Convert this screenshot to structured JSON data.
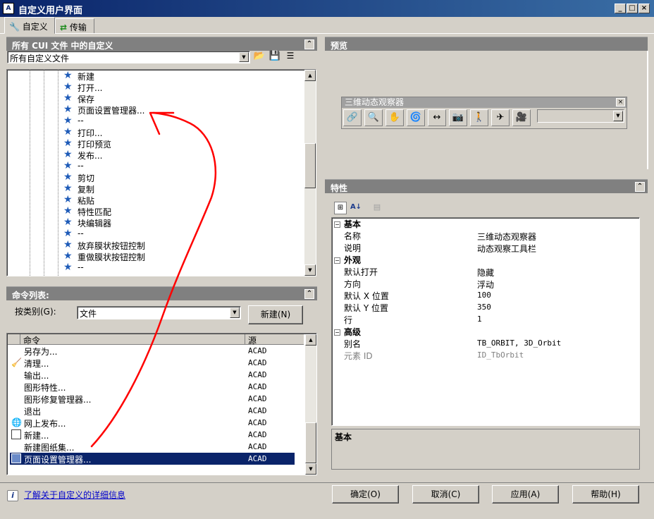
{
  "window": {
    "title": "自定义用户界面",
    "buttons": [
      "_",
      "□",
      "×"
    ]
  },
  "tabs": [
    {
      "label": "自定义"
    },
    {
      "label": "传输"
    }
  ],
  "cui_panel": {
    "title": "所有 CUI 文件 中的自定义",
    "file_filter": "所有自定义文件",
    "tree_items": [
      "新建",
      "打开...",
      "保存",
      "页面设置管理器...",
      "--",
      "打印...",
      "打印预览",
      "发布...",
      "--",
      "剪切",
      "复制",
      "粘贴",
      "特性匹配",
      "块编辑器",
      "--",
      "放弃膜状按钮控制",
      "重做膜状按钮控制",
      "--"
    ]
  },
  "command_panel": {
    "title": "命令列表:",
    "category_label": "按类别(G):",
    "category_value": "文件",
    "new_button": "新建(N)",
    "col_command": "命令",
    "col_source": "源",
    "rows": [
      {
        "name": "另存为...",
        "source": "ACAD",
        "icon": ""
      },
      {
        "name": "清理...",
        "source": "ACAD",
        "icon": "broom-icon"
      },
      {
        "name": "输出...",
        "source": "ACAD",
        "icon": ""
      },
      {
        "name": "图形特性...",
        "source": "ACAD",
        "icon": ""
      },
      {
        "name": "图形修复管理器...",
        "source": "ACAD",
        "icon": ""
      },
      {
        "name": "退出",
        "source": "ACAD",
        "icon": ""
      },
      {
        "name": "网上发布...",
        "source": "ACAD",
        "icon": "globe-icon"
      },
      {
        "name": "新建...",
        "source": "ACAD",
        "icon": "new-document-icon"
      },
      {
        "name": "新建图纸集...",
        "source": "ACAD",
        "icon": ""
      },
      {
        "name": "页面设置管理器...",
        "source": "ACAD",
        "icon": "page-setup-icon",
        "selected": true
      }
    ]
  },
  "preview_panel": {
    "title": "预览",
    "toolbar_title": "三维动态观察器"
  },
  "properties_panel": {
    "title": "特性",
    "groups": [
      {
        "name": "基本",
        "rows": [
          {
            "key": "名称",
            "value": "三维动态观察器"
          },
          {
            "key": "说明",
            "value": "动态观察工具栏"
          }
        ]
      },
      {
        "name": "外观",
        "rows": [
          {
            "key": "默认打开",
            "value": "隐藏"
          },
          {
            "key": "方向",
            "value": "浮动"
          },
          {
            "key": "默认 X 位置",
            "value": "100"
          },
          {
            "key": "默认 Y 位置",
            "value": "350"
          },
          {
            "key": "行",
            "value": "1"
          }
        ]
      },
      {
        "name": "高级",
        "rows": [
          {
            "key": "别名",
            "value": "TB_ORBIT, 3D_Orbit"
          },
          {
            "key": "元素 ID",
            "value": "ID_TbOrbit",
            "disabled": true
          }
        ]
      }
    ],
    "description_title": "基本"
  },
  "footer": {
    "help_link": "了解关于自定义的详细信息",
    "ok": "确定(O)",
    "cancel": "取消(C)",
    "apply": "应用(A)",
    "help": "帮助(H)"
  },
  "colors": {
    "selection": "#0a246a",
    "annotation": "#ff0000",
    "star": "#1e5bb8"
  }
}
